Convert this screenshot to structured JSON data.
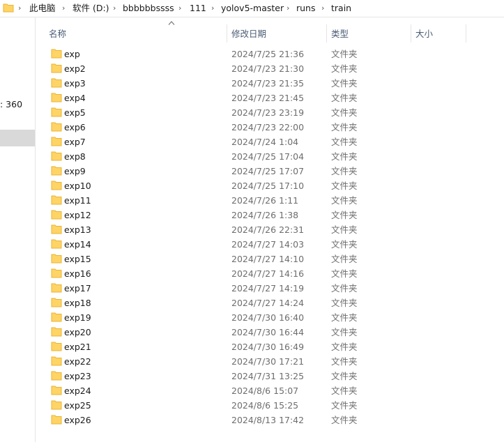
{
  "address_bar": {
    "separator": "›",
    "crumbs": [
      "此电脑",
      "软件 (D:)",
      "bbbbbbssss",
      "111",
      "yolov5-master",
      "runs",
      "train"
    ]
  },
  "nav_pane": {
    "partial_item_text": ": 360"
  },
  "columns": {
    "name": "名称",
    "date": "修改日期",
    "type": "类型",
    "size": "大小"
  },
  "files": [
    {
      "name": "exp",
      "date": "2024/7/25 21:36",
      "type": "文件夹"
    },
    {
      "name": "exp2",
      "date": "2024/7/23 21:30",
      "type": "文件夹"
    },
    {
      "name": "exp3",
      "date": "2024/7/23 21:35",
      "type": "文件夹"
    },
    {
      "name": "exp4",
      "date": "2024/7/23 21:45",
      "type": "文件夹"
    },
    {
      "name": "exp5",
      "date": "2024/7/23 23:19",
      "type": "文件夹"
    },
    {
      "name": "exp6",
      "date": "2024/7/23 22:00",
      "type": "文件夹"
    },
    {
      "name": "exp7",
      "date": "2024/7/24 1:04",
      "type": "文件夹"
    },
    {
      "name": "exp8",
      "date": "2024/7/25 17:04",
      "type": "文件夹"
    },
    {
      "name": "exp9",
      "date": "2024/7/25 17:07",
      "type": "文件夹"
    },
    {
      "name": "exp10",
      "date": "2024/7/25 17:10",
      "type": "文件夹"
    },
    {
      "name": "exp11",
      "date": "2024/7/26 1:11",
      "type": "文件夹"
    },
    {
      "name": "exp12",
      "date": "2024/7/26 1:38",
      "type": "文件夹"
    },
    {
      "name": "exp13",
      "date": "2024/7/26 22:31",
      "type": "文件夹"
    },
    {
      "name": "exp14",
      "date": "2024/7/27 14:03",
      "type": "文件夹"
    },
    {
      "name": "exp15",
      "date": "2024/7/27 14:10",
      "type": "文件夹"
    },
    {
      "name": "exp16",
      "date": "2024/7/27 14:16",
      "type": "文件夹"
    },
    {
      "name": "exp17",
      "date": "2024/7/27 14:19",
      "type": "文件夹"
    },
    {
      "name": "exp18",
      "date": "2024/7/27 14:24",
      "type": "文件夹"
    },
    {
      "name": "exp19",
      "date": "2024/7/30 16:40",
      "type": "文件夹"
    },
    {
      "name": "exp20",
      "date": "2024/7/30 16:44",
      "type": "文件夹"
    },
    {
      "name": "exp21",
      "date": "2024/7/30 16:49",
      "type": "文件夹"
    },
    {
      "name": "exp22",
      "date": "2024/7/30 17:21",
      "type": "文件夹"
    },
    {
      "name": "exp23",
      "date": "2024/7/31 13:25",
      "type": "文件夹"
    },
    {
      "name": "exp24",
      "date": "2024/8/6 15:07",
      "type": "文件夹"
    },
    {
      "name": "exp25",
      "date": "2024/8/6 15:25",
      "type": "文件夹"
    },
    {
      "name": "exp26",
      "date": "2024/8/13 17:42",
      "type": "文件夹"
    }
  ],
  "icons": {
    "folder": "folder-icon",
    "sort": "sort-up-icon"
  },
  "colors": {
    "folder_fill": "#ffd466",
    "folder_edge": "#e8b431",
    "header_text": "#4a5c74",
    "secondary_text": "#6d6d6d"
  }
}
